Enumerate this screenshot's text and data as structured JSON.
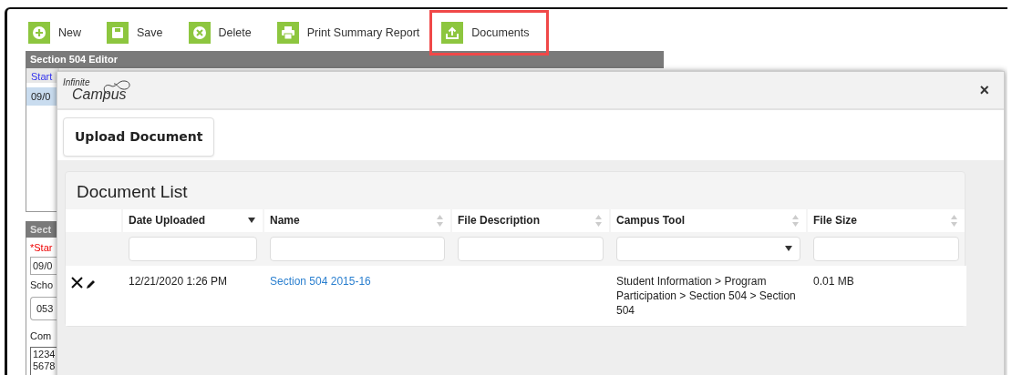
{
  "toolbar": [
    {
      "label": "New",
      "highlighted": false
    },
    {
      "label": "Save",
      "highlighted": false
    },
    {
      "label": "Delete",
      "highlighted": false
    },
    {
      "label": "Print Summary Report",
      "highlighted": false
    },
    {
      "label": "Documents",
      "highlighted": true
    }
  ],
  "editor": {
    "title": "Section 504 Editor",
    "list_header": "Start",
    "list_rows": [
      {
        "text": "09/0",
        "selected": true
      }
    ],
    "detail_title": "Sect",
    "fields": [
      {
        "kind": "label",
        "text": "*Star",
        "required": true
      },
      {
        "kind": "input",
        "text": "09/0"
      },
      {
        "kind": "label",
        "text": "Scho",
        "required": false
      },
      {
        "kind": "select",
        "text": "053"
      },
      {
        "kind": "label",
        "text": "Com",
        "required": false
      },
      {
        "kind": "textarea",
        "lines": [
          "1234",
          "5678"
        ]
      }
    ]
  },
  "modal": {
    "logo_top": "Infinite",
    "logo_bottom": "Campus",
    "close": "×",
    "upload_button": "Upload Document",
    "document_list": {
      "title": "Document List",
      "columns": [
        {
          "label": "Date Uploaded",
          "sorted": true,
          "kind": "text"
        },
        {
          "label": "Name",
          "sorted": false,
          "kind": "text"
        },
        {
          "label": "File Description",
          "sorted": false,
          "kind": "text"
        },
        {
          "label": "Campus Tool",
          "sorted": false,
          "kind": "select"
        },
        {
          "label": "File Size",
          "sorted": false,
          "kind": "text"
        }
      ],
      "rows": [
        {
          "date": "12/21/2020 1:26 PM",
          "name": "Section 504 2015-16",
          "tool": "Student Information > Program Participation > Section 504 > Section 504",
          "size": "0.01 MB"
        }
      ]
    }
  }
}
